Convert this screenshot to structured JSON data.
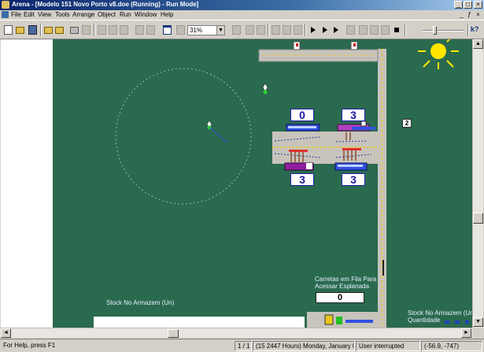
{
  "window": {
    "title": "Arena - [Modelo 151 Novo Porto v8.doe (Running) - Run Mode]",
    "minimize_glyph": "_",
    "maximize_glyph": "□",
    "close_glyph": "×",
    "child_min_glyph": "_",
    "child_restore_glyph": "ƒ",
    "child_close_glyph": "×"
  },
  "menu": {
    "items": [
      "File",
      "Edit",
      "View",
      "Tools",
      "Arrange",
      "Object",
      "Run",
      "Window",
      "Help"
    ]
  },
  "toolbar": {
    "zoom_value": "31%",
    "zoom_arrow": "▼",
    "help_glyph": "k?"
  },
  "canvas": {
    "counters": {
      "top_left": "0",
      "top_right": "3",
      "bottom_left": "3",
      "bottom_right": "3"
    },
    "marker_box": "2",
    "queue_label_line1": "Carretas em Fila Para",
    "queue_label_line2": "Acessar Esplanada",
    "queue_value": "0",
    "storage_label_left": "Stock No Armazem (Un)",
    "storage_label_right_line1": "Stock No Armazem (Un)",
    "storage_label_right_line2": "Quantidade",
    "colors": {
      "background": "#2a6a4f",
      "road": "#c8c4bc",
      "road_line": "#e8c820",
      "sun": "#ffe600",
      "counter_text": "#1a1aa0",
      "truck_purple": "#b040c0",
      "truck_blue": "#3050e0"
    }
  },
  "scrollbars": {
    "up_glyph": "▲",
    "down_glyph": "▼",
    "left_glyph": "◄",
    "right_glyph": "►"
  },
  "status": {
    "help": "For Help, press F1",
    "replication": "1 / 1",
    "sim_time": "(15 2447 Hours) Monday, January 0... 2007",
    "state": "User interrupted",
    "coordinates": "(-56.9, -747)"
  }
}
